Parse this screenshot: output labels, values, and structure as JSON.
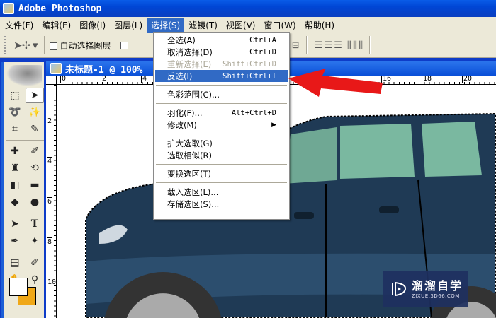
{
  "app": {
    "title": "Adobe Photoshop"
  },
  "menubar": [
    {
      "label": "文件(F)"
    },
    {
      "label": "编辑(E)"
    },
    {
      "label": "图像(I)"
    },
    {
      "label": "图层(L)"
    },
    {
      "label": "选择(S)",
      "active": true
    },
    {
      "label": "滤镜(T)"
    },
    {
      "label": "视图(V)"
    },
    {
      "label": "窗口(W)"
    },
    {
      "label": "帮助(H)"
    }
  ],
  "options": {
    "auto_select_label": "自动选择图层"
  },
  "document": {
    "title": "未标题-1 @ 100%",
    "ruler_top": [
      "0",
      "2",
      "4",
      "16",
      "18",
      "20"
    ],
    "ruler_left": [
      "2",
      "4",
      "6",
      "8",
      "10"
    ]
  },
  "select_menu": {
    "items": [
      {
        "label": "全选(A)",
        "shortcut": "Ctrl+A"
      },
      {
        "label": "取消选择(D)",
        "shortcut": "Ctrl+D"
      },
      {
        "label": "重新选择(E)",
        "shortcut": "Shift+Ctrl+D",
        "disabled": true
      },
      {
        "label": "反选(I)",
        "shortcut": "Shift+Ctrl+I",
        "highlighted": true
      },
      {
        "label": "色彩范围(C)...",
        "shortcut": ""
      },
      {
        "label": "羽化(F)...",
        "shortcut": "Alt+Ctrl+D"
      },
      {
        "label": "修改(M)",
        "shortcut": "",
        "submenu": true
      },
      {
        "label": "扩大选取(G)",
        "shortcut": ""
      },
      {
        "label": "选取相似(R)",
        "shortcut": ""
      },
      {
        "label": "变换选区(T)",
        "shortcut": ""
      },
      {
        "label": "载入选区(L)...",
        "shortcut": ""
      },
      {
        "label": "存储选区(S)...",
        "shortcut": ""
      }
    ]
  },
  "watermark": {
    "cn": "溜溜自学",
    "en": "ZIXUE.3D66.COM"
  },
  "colors": {
    "foreground": "#ffffff",
    "background": "#f0a818",
    "accent": "#316ac5",
    "arrow": "#e81818"
  }
}
